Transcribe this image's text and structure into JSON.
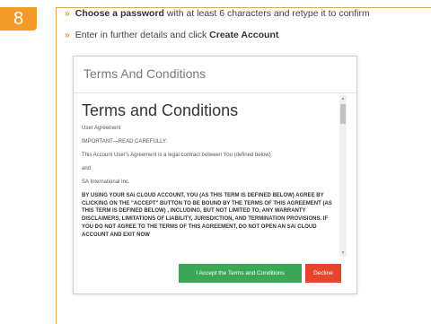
{
  "step": {
    "number": "8"
  },
  "instructions": [
    {
      "bullet": "»",
      "bold": "Choose a password",
      "rest": " with at least 6 characters and retype it to confirm"
    },
    {
      "bullet": "»",
      "lead": "Enter in further details and click ",
      "bold": "Create Account"
    }
  ],
  "modal": {
    "title": "Terms And Conditions",
    "heading": "Terms and Conditions",
    "paragraphs": [
      "User Agreement",
      "IMPORTANT—READ CAREFULLY:",
      "This Account User's Agreement is a legal contract between You (defined below)",
      "and",
      "SA International Inc.",
      "BY USING YOUR SAi CLOUD ACCOUNT,  YOU (AS THIS TERM IS DEFINED BELOW) AGREE BY CLICKING ON THE \"ACCEPT\" BUTTON TO BE BOUND BY THE TERMS OF THIS AGREEMENT (AS THIS TERM IS DEFINED BELOW) , INCLUDING, BUT NOT LIMITED TO, ANY WARRANTY DISCLAIMERS, LIMITATIONS OF LIABILITY, JURISDICTION, AND TERMINATION PROVISIONS. IF YOU DO NOT AGREE TO THE TERMS OF THIS AGREEMENT, DO NOT OPEN AN SAi CLOUD ACCOUNT AND EXIT NOW"
    ],
    "accept_label": "I Accept the Terms and Conditions",
    "decline_label": "Decline"
  },
  "colors": {
    "accent_orange": "#f39a2a",
    "accept_green": "#3aa757",
    "decline_red": "#e5452a"
  }
}
